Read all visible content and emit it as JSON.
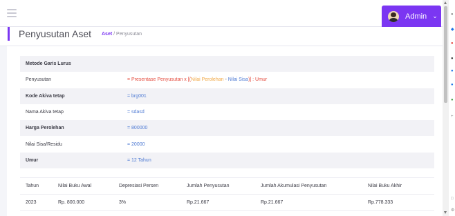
{
  "topbar": {
    "user_label": "Admin"
  },
  "header": {
    "title": "Penyusutan Aset",
    "breadcrumb_link": "Aset",
    "breadcrumb_sep": " / ",
    "breadcrumb_current": "Penyusutan"
  },
  "info": {
    "method_title": "Metode Garis Lurus",
    "formula_label": "Penyusutan",
    "formula_prefix": "= Presentase Penyusutan x [(",
    "formula_nilai_perolehan": "Nilai Perolehan",
    "formula_minus": " - ",
    "formula_nilai_sisa": "Nilai Sisa",
    "formula_suffix": ")] : Umur",
    "rows": [
      {
        "label": "Kode Akiva tetap",
        "value": "= brg001"
      },
      {
        "label": "Nama Akiva tetap",
        "value": "= sdasd"
      },
      {
        "label": "Harga Perolehan",
        "value": "= 800000"
      },
      {
        "label": "Nilai Sisa/Residu",
        "value": "= 20000"
      },
      {
        "label": "Umur",
        "value": "= 12 Tahun"
      }
    ]
  },
  "table": {
    "headers": [
      "Tahun",
      "Nilai Buku Awal",
      "Depresiasi Persen",
      "Jumlah Penyusutan",
      "Jumlah Akumulasi Penyusutan",
      "Nilai Buku Akhir"
    ],
    "rows": [
      [
        "2023",
        "Rp. 800.000",
        "3%",
        "Rp.21.667",
        "Rp.21.667",
        "Rp.778.333"
      ]
    ]
  },
  "colors": {
    "accent": "#7b36f2",
    "link_blue": "#4f7bd4",
    "formula_red": "#e4483a",
    "formula_orange": "#f1a640"
  }
}
